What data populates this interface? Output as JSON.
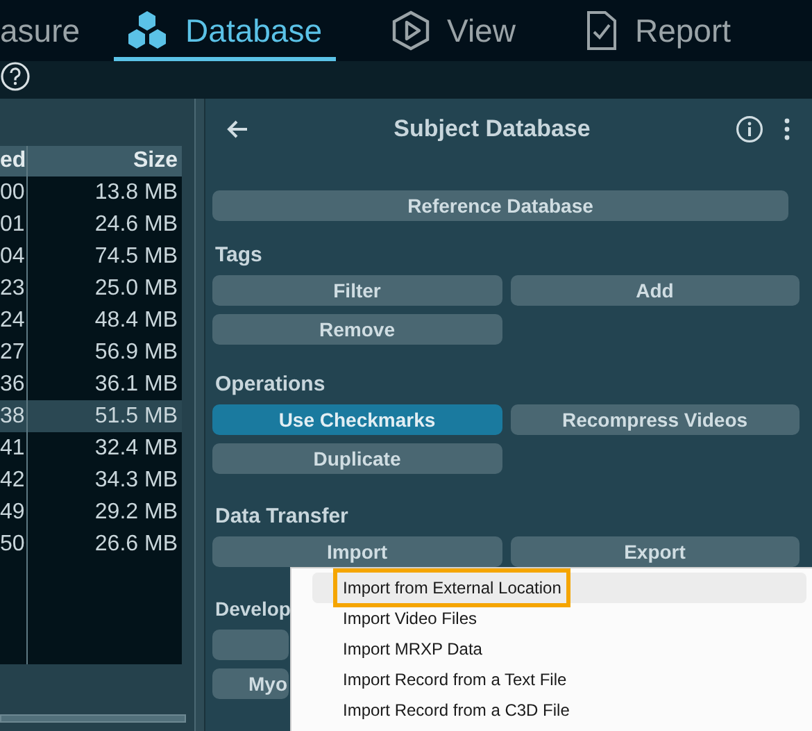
{
  "nav_tabs": [
    {
      "label": "asure",
      "selected": false
    },
    {
      "label": "Database",
      "selected": true
    },
    {
      "label": "View",
      "selected": false
    },
    {
      "label": "Report",
      "selected": false
    }
  ],
  "table": {
    "columns": [
      "ed",
      "Size"
    ],
    "rows": [
      {
        "cells": [
          "00",
          "13.8 MB"
        ],
        "selected": false
      },
      {
        "cells": [
          "01",
          "24.6 MB"
        ],
        "selected": false
      },
      {
        "cells": [
          "04",
          "74.5 MB"
        ],
        "selected": false
      },
      {
        "cells": [
          "23",
          "25.0 MB"
        ],
        "selected": false
      },
      {
        "cells": [
          "24",
          "48.4 MB"
        ],
        "selected": false
      },
      {
        "cells": [
          "27",
          "56.9 MB"
        ],
        "selected": false
      },
      {
        "cells": [
          "36",
          "36.1 MB"
        ],
        "selected": false
      },
      {
        "cells": [
          "38",
          "51.5 MB"
        ],
        "selected": true
      },
      {
        "cells": [
          "41",
          "32.4 MB"
        ],
        "selected": false
      },
      {
        "cells": [
          "42",
          "34.3 MB"
        ],
        "selected": false
      },
      {
        "cells": [
          "49",
          "29.2 MB"
        ],
        "selected": false
      },
      {
        "cells": [
          "50",
          "26.6 MB"
        ],
        "selected": false
      }
    ]
  },
  "panel": {
    "title": "Subject Database",
    "sections": [
      {
        "kind": "full",
        "buttons": [
          {
            "label": "Reference Database",
            "primary": false,
            "wide": true
          }
        ]
      },
      {
        "kind": "full",
        "heading": "Tags",
        "buttons": [
          {
            "label": "Filter",
            "primary": false,
            "wide": false
          },
          {
            "label": "Add",
            "primary": false,
            "wide": false
          },
          {
            "label": "Remove",
            "primary": false,
            "wide": false
          }
        ]
      },
      {
        "kind": "full",
        "heading": "Operations",
        "buttons": [
          {
            "label": "Use Checkmarks",
            "primary": true,
            "wide": false
          },
          {
            "label": "Recompress Videos",
            "primary": false,
            "wide": false
          },
          {
            "label": "Duplicate",
            "primary": false,
            "wide": false
          }
        ]
      },
      {
        "kind": "full",
        "heading": "Data Transfer",
        "buttons": [
          {
            "label": "Import",
            "primary": false,
            "wide": false
          },
          {
            "label": "Export",
            "primary": false,
            "wide": false
          }
        ]
      },
      {
        "kind": "clipped",
        "heading": "Develop",
        "buttons": [
          {
            "primary": false,
            "wide": false
          },
          {
            "label": "Myo",
            "primary": false,
            "wide": false
          }
        ]
      }
    ]
  },
  "menu": {
    "items": [
      {
        "label": "Import from External Location",
        "highlighted": true
      },
      {
        "label": "Import Video Files",
        "highlighted": false
      },
      {
        "label": "Import MRXP Data",
        "highlighted": false
      },
      {
        "label": "Import Record from a Text File",
        "highlighted": false
      },
      {
        "label": "Import Record from a C3D File",
        "highlighted": false
      }
    ]
  }
}
